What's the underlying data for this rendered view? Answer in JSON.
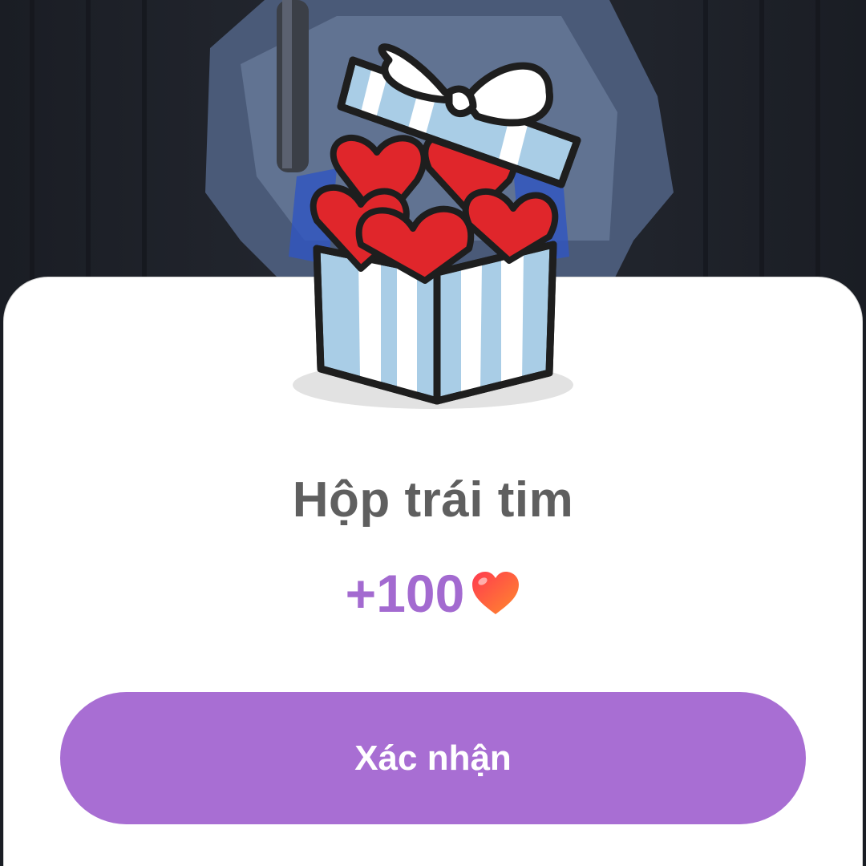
{
  "dialog": {
    "title": "Hộp trái tim",
    "reward_amount": "+100",
    "reward_icon": "heart-icon",
    "confirm_label": "Xác nhận"
  },
  "illustration": {
    "name": "gift-box-with-hearts",
    "box_color": "#a9cde6",
    "heart_color": "#e0262b",
    "ribbon_color": "#ffffff"
  },
  "colors": {
    "accent": "#a86ed3",
    "title_text": "#5f5f5f",
    "reward_text": "#a36ad0",
    "sheet_background": "#ffffff"
  }
}
